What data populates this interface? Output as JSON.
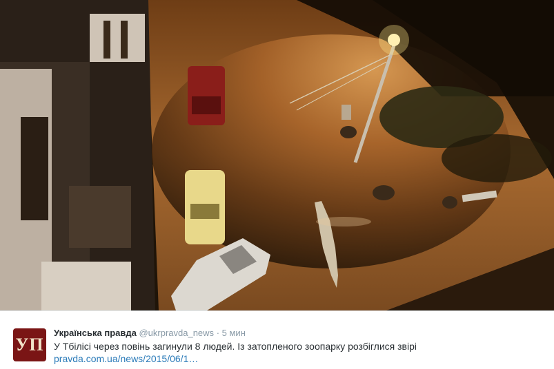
{
  "photo": {
    "description_icon": "flood-photo"
  },
  "tweet": {
    "avatar_text": "УП",
    "name": "Українська правда",
    "handle": "@ukrpravda_news",
    "separator": "·",
    "time": "5 мин",
    "text": "У Тбілісі через повінь загинули 8 людей. Із затопленого зоопарку розбіглися звірі ",
    "link": "pravda.com.ua/news/2015/06/1…"
  },
  "colors": {
    "name": "#292f33",
    "meta": "#8899a6",
    "link": "#2b7bb9",
    "avatar_bg": "#7a1515"
  }
}
